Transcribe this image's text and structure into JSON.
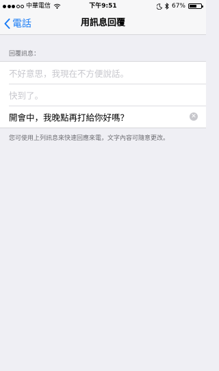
{
  "status_bar": {
    "carrier": "中華電信",
    "time": "下午9:51",
    "battery": "67%",
    "battery_level": 0.67
  },
  "nav": {
    "back_label": "電話",
    "title": "用訊息回覆"
  },
  "section": {
    "header": "回覆訊息："
  },
  "replies": [
    {
      "placeholder": "不好意思，我現在不方便說話。",
      "value": ""
    },
    {
      "placeholder": "快到了。",
      "value": ""
    },
    {
      "placeholder": "",
      "value": "開會中，我晚點再打給你好嗎？"
    }
  ],
  "footer": "您可使用上列訊息來快速回應來電，文字內容可隨意更改。",
  "icons": {
    "back": "chevron-left-icon",
    "wifi": "wifi-icon",
    "moon": "moon-icon",
    "bluetooth": "bluetooth-icon",
    "battery": "battery-icon",
    "clear": "clear-icon"
  },
  "colors": {
    "accent": "#1a7cf5",
    "background": "#efeff4",
    "placeholder": "#c7c7cd"
  }
}
